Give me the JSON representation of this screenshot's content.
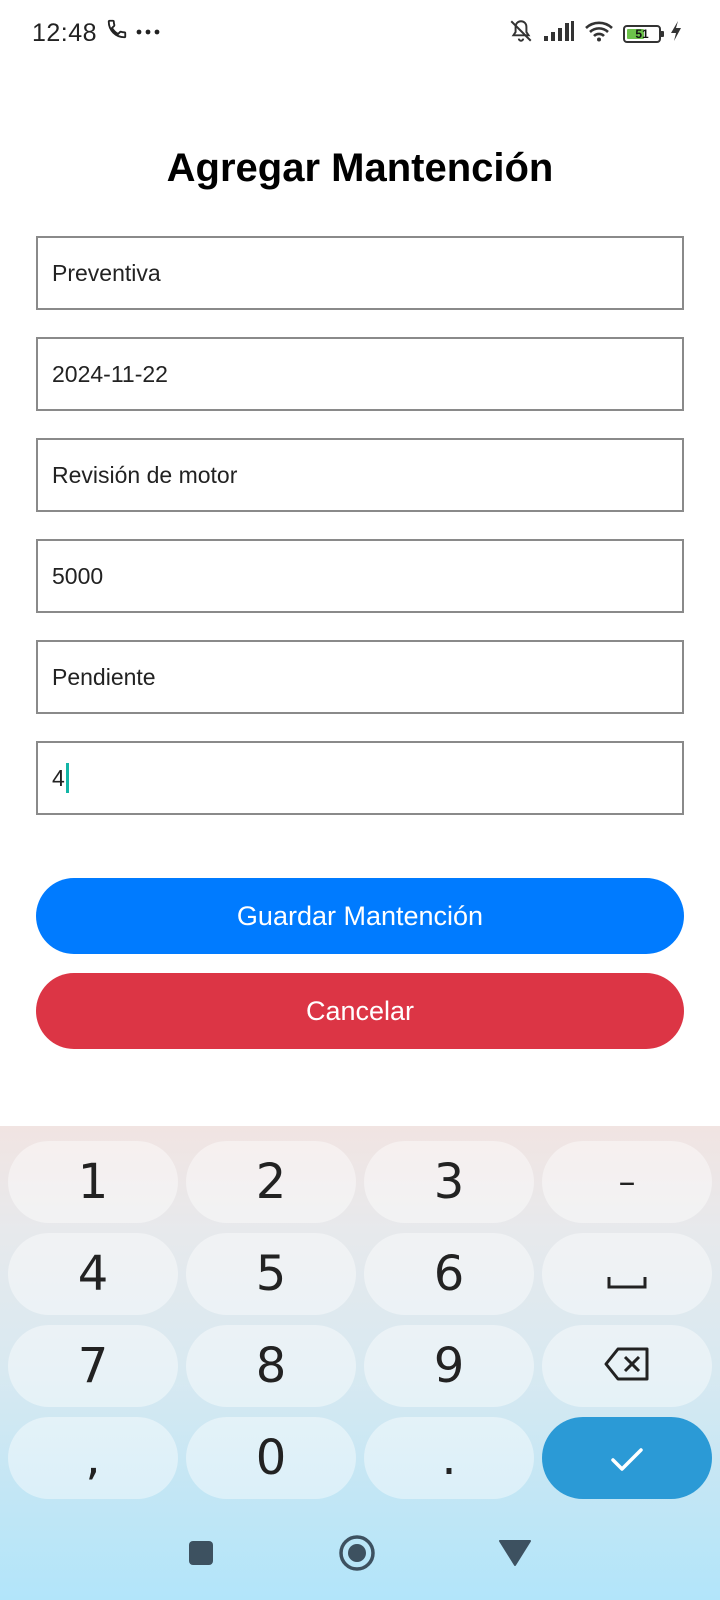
{
  "status_bar": {
    "time": "12:48",
    "call_icon": "phone-icon",
    "more_icon": "more-dots-icon",
    "bell_icon": "bell-off-icon",
    "signal_icon": "signal-icon",
    "wifi_icon": "wifi-icon",
    "battery_level": "51",
    "charging_icon": "charging-bolt-icon"
  },
  "form": {
    "title": "Agregar Mantención",
    "fields": [
      {
        "value": "Preventiva"
      },
      {
        "value": "2024-11-22"
      },
      {
        "value": "Revisión de motor"
      },
      {
        "value": "5000"
      },
      {
        "value": "Pendiente"
      },
      {
        "value": "4"
      }
    ],
    "save_label": "Guardar Mantención",
    "cancel_label": "Cancelar"
  },
  "colors": {
    "primary": "#007bff",
    "danger": "#dc3545",
    "enter_key": "#2b9ad6",
    "caret": "#12b5a6"
  },
  "keyboard": {
    "rows": [
      [
        "1",
        "2",
        "3",
        "–"
      ],
      [
        "4",
        "5",
        "6",
        "space-icon"
      ],
      [
        "7",
        "8",
        "9",
        "backspace-icon"
      ],
      [
        ",",
        "0",
        ".",
        "check-icon"
      ]
    ],
    "key_1": "1",
    "key_2": "2",
    "key_3": "3",
    "key_dash": "–",
    "key_4": "4",
    "key_5": "5",
    "key_6": "6",
    "key_7": "7",
    "key_8": "8",
    "key_9": "9",
    "key_comma": ",",
    "key_0": "0",
    "key_period": "."
  },
  "nav_bar": {
    "recents_icon": "square-recents-icon",
    "home_icon": "circle-home-icon",
    "back_icon": "triangle-back-icon"
  }
}
